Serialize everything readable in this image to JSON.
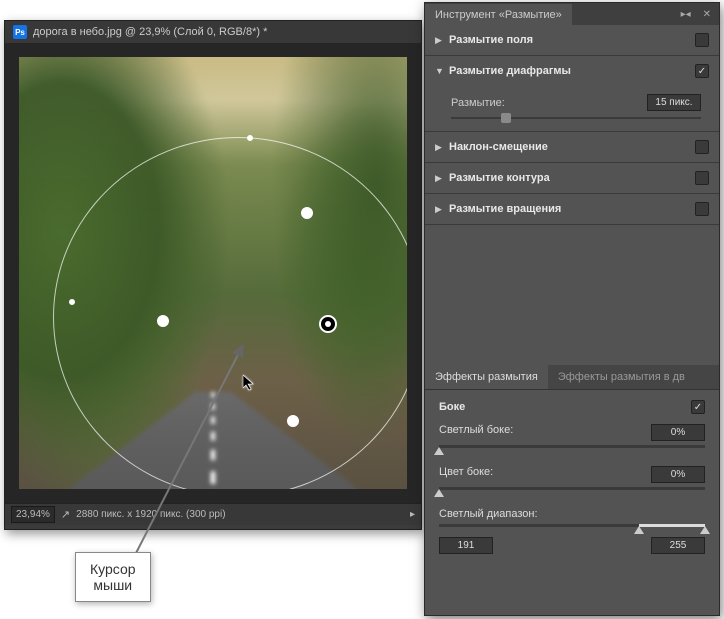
{
  "doc": {
    "title": "дорога в небо.jpg @ 23,9% (Слой 0, RGB/8*) *",
    "zoom": "23,94%",
    "dims": "2880 пикс. x 1920 пикс. (300 ppi)"
  },
  "panel": {
    "title": "Инструмент «Размытие»",
    "sections": {
      "field": {
        "title": "Размытие поля",
        "enabled": false,
        "expanded": false
      },
      "iris": {
        "title": "Размытие диафрагмы",
        "enabled": true,
        "expanded": true,
        "blur_label": "Размытие:",
        "blur_value": "15 пикс.",
        "blur_slider_pct": 22
      },
      "tilt": {
        "title": "Наклон-смещение",
        "enabled": false,
        "expanded": false
      },
      "path": {
        "title": "Размытие контура",
        "enabled": false,
        "expanded": false
      },
      "spin": {
        "title": "Размытие вращения",
        "enabled": false,
        "expanded": false
      }
    }
  },
  "effects": {
    "tab_active": "Эффекты размытия",
    "tab_other": "Эффекты размытия в дв",
    "bokeh": {
      "title": "Боке",
      "enabled": true,
      "light": {
        "label": "Светлый боке:",
        "value": "0%",
        "pct": 0
      },
      "color": {
        "label": "Цвет боке:",
        "value": "0%",
        "pct": 0
      },
      "range": {
        "label": "Светлый диапазон:",
        "low": "191",
        "high": "255",
        "low_pct": 75,
        "high_pct": 100
      }
    }
  },
  "callout": {
    "line1": "Курсор",
    "line2": "мыши"
  }
}
